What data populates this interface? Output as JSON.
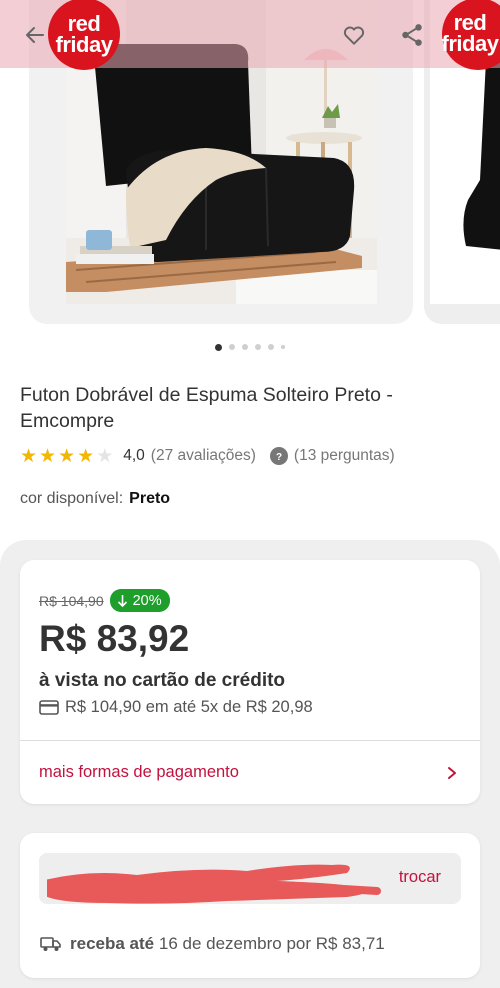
{
  "header": {
    "badge_line1": "red",
    "badge_line2": "friday",
    "back_icon": "arrow-left-icon",
    "favorite_icon": "heart-icon",
    "share_icon": "share-icon"
  },
  "carousel": {
    "total_slides": 6,
    "active_index": 0
  },
  "product": {
    "title": "Futon Dobrável de Espuma Solteiro Preto - Emcompre",
    "rating": 4,
    "rating_max": 5,
    "rating_label": "4,0",
    "reviews_label": "(27 avaliações)",
    "questions_label": "(13 perguntas)",
    "color_label": "cor disponível:",
    "color_value": "Preto"
  },
  "pricing": {
    "old_price": "R$ 104,90",
    "discount": "20%",
    "price": "R$ 83,92",
    "cash_label": "à vista no cartão de crédito",
    "installments": "R$ 104,90 em até 5x de R$ 20,98",
    "more_payments": "mais formas de pagamento"
  },
  "shipping": {
    "change_label": "trocar",
    "delivery_bold": "receba até",
    "delivery_rest": "16 de dezembro por R$ 83,71"
  },
  "colors": {
    "accent": "#c2123e",
    "badge": "#d9141e",
    "discount_green": "#1e9e2a",
    "star": "#f2b705",
    "scribble": "#e85a5a"
  }
}
